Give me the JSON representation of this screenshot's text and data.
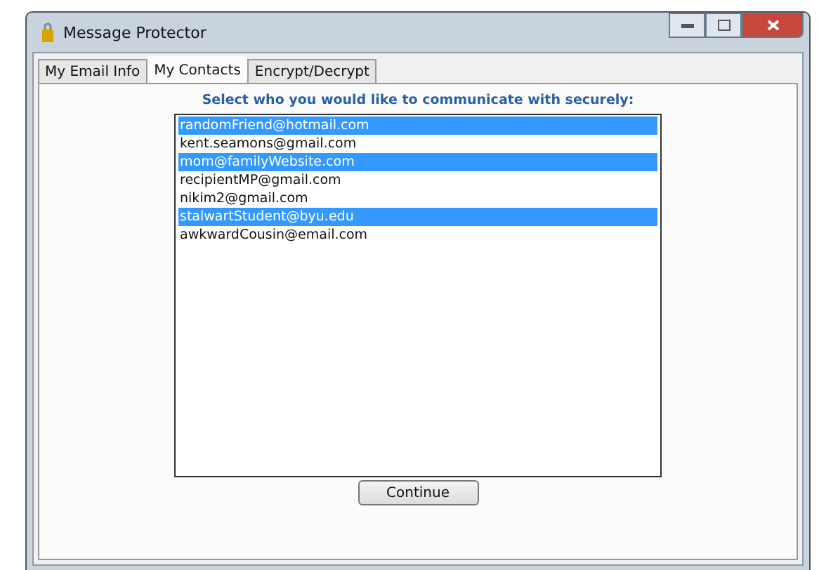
{
  "window": {
    "title": "Message Protector"
  },
  "tabs": [
    {
      "label": "My Email Info",
      "selected": false
    },
    {
      "label": "My Contacts",
      "selected": true
    },
    {
      "label": "Encrypt/Decrypt",
      "selected": false
    }
  ],
  "heading": "Select who you would like to communicate with securely:",
  "contacts": [
    {
      "email": "randomFriend@hotmail.com",
      "selected": true
    },
    {
      "email": "kent.seamons@gmail.com",
      "selected": false
    },
    {
      "email": "mom@familyWebsite.com",
      "selected": true
    },
    {
      "email": "recipientMP@gmail.com",
      "selected": false
    },
    {
      "email": "nikim2@gmail.com",
      "selected": false
    },
    {
      "email": "stalwartStudent@byu.edu",
      "selected": true
    },
    {
      "email": "awkwardCousin@email.com",
      "selected": false
    }
  ],
  "buttons": [
    "Continue"
  ]
}
